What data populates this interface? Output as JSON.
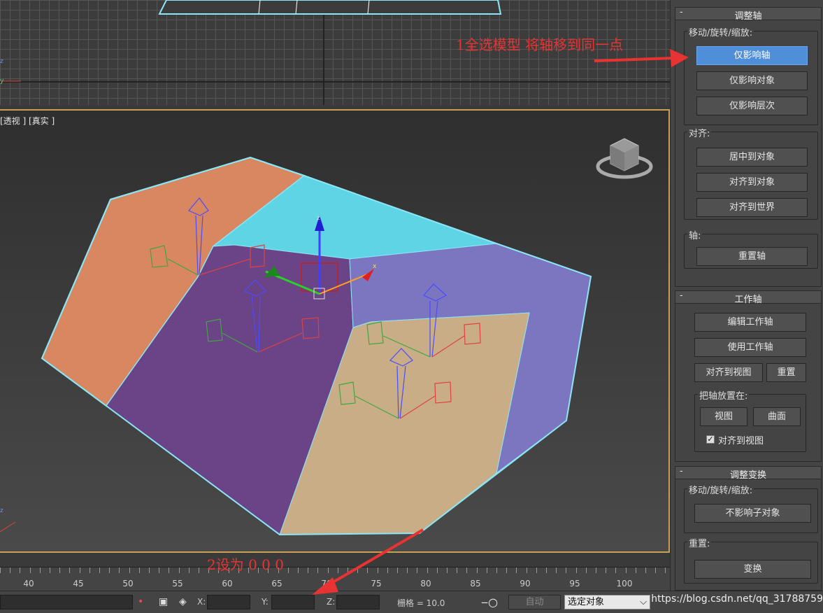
{
  "viewport": {
    "persp_label": "[透视 ] [真实 ]"
  },
  "ruler": {
    "numbers": [
      "40",
      "45",
      "50",
      "55",
      "60",
      "65",
      "70",
      "75",
      "80",
      "85",
      "90",
      "95",
      "100"
    ]
  },
  "statusbar": {
    "x_label": "X:",
    "y_label": "Y:",
    "z_label": "Z:",
    "grid_text": "栅格 = 10.0",
    "auto_label": "自动",
    "selected_option": "选定对象"
  },
  "panel": {
    "adjust_pivot": {
      "title": "调整轴",
      "move_group": "移动/旋转/缩放:",
      "btn_affect_pivot": "仅影响轴",
      "btn_affect_object": "仅影响对象",
      "btn_affect_hierarchy": "仅影响层次",
      "align_group": "对齐:",
      "btn_center_object": "居中到对象",
      "btn_align_object": "对齐到对象",
      "btn_align_world": "对齐到世界",
      "pivot_group": "轴:",
      "btn_reset_pivot": "重置轴"
    },
    "working_pivot": {
      "title": "工作轴",
      "btn_edit": "编辑工作轴",
      "btn_use": "使用工作轴",
      "btn_align_view": "对齐到视图",
      "btn_reset": "重置",
      "place_group": "把轴放置在:",
      "btn_view": "视图",
      "btn_surface": "曲面",
      "chk_align_view": "对齐到视图"
    },
    "adjust_transform": {
      "title": "调整变换",
      "move_group": "移动/旋转/缩放:",
      "btn_dont_affect_children": "不影响子对象",
      "reset_group": "重置:",
      "btn_transform": "变换"
    }
  },
  "annotations": {
    "note1": "1全选模型 将轴移到同一点",
    "note2": "2设为 0 0 0",
    "color": "#e83333"
  },
  "watermark": "https://blog.csdn.net/qq_31788759",
  "colors": {
    "accent": "#4f8fd9",
    "face_orange": "#e0906a",
    "face_cyan": "#5fd4e4",
    "face_purple": "#6a4487",
    "face_violet": "#7c76c0",
    "face_tan": "#d4b890"
  }
}
